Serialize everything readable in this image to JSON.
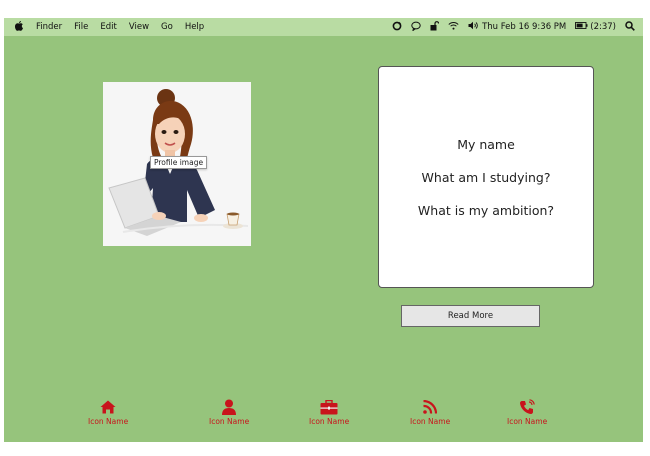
{
  "menubar": {
    "apple_icon": "apple-icon",
    "items": [
      "Finder",
      "File",
      "Edit",
      "View",
      "Go",
      "Help"
    ],
    "status_icons": [
      "sync-icon",
      "chat-icon",
      "lock-icon",
      "wifi-icon"
    ],
    "volume_icon": "volume-icon",
    "datetime": "Thu Feb 16 9:36 PM",
    "battery": "(2:37)",
    "search_icon": "search-icon"
  },
  "profile": {
    "tooltip": "Profile image",
    "image_icon": "woman-at-laptop-illustration"
  },
  "card": {
    "line1": "My name",
    "line2": "What am I studying?",
    "line3": "What is my ambition?"
  },
  "read_more": "Read More",
  "bottom_nav": [
    {
      "icon": "home-icon",
      "label": "Icon Name"
    },
    {
      "icon": "user-icon",
      "label": "Icon Name"
    },
    {
      "icon": "briefcase-icon",
      "label": "Icon Name"
    },
    {
      "icon": "rss-icon",
      "label": "Icon Name"
    },
    {
      "icon": "phone-icon",
      "label": "Icon Name"
    }
  ],
  "colors": {
    "background": "#96c47c",
    "menubar": "#b9dca3",
    "accent": "#c8141c"
  }
}
